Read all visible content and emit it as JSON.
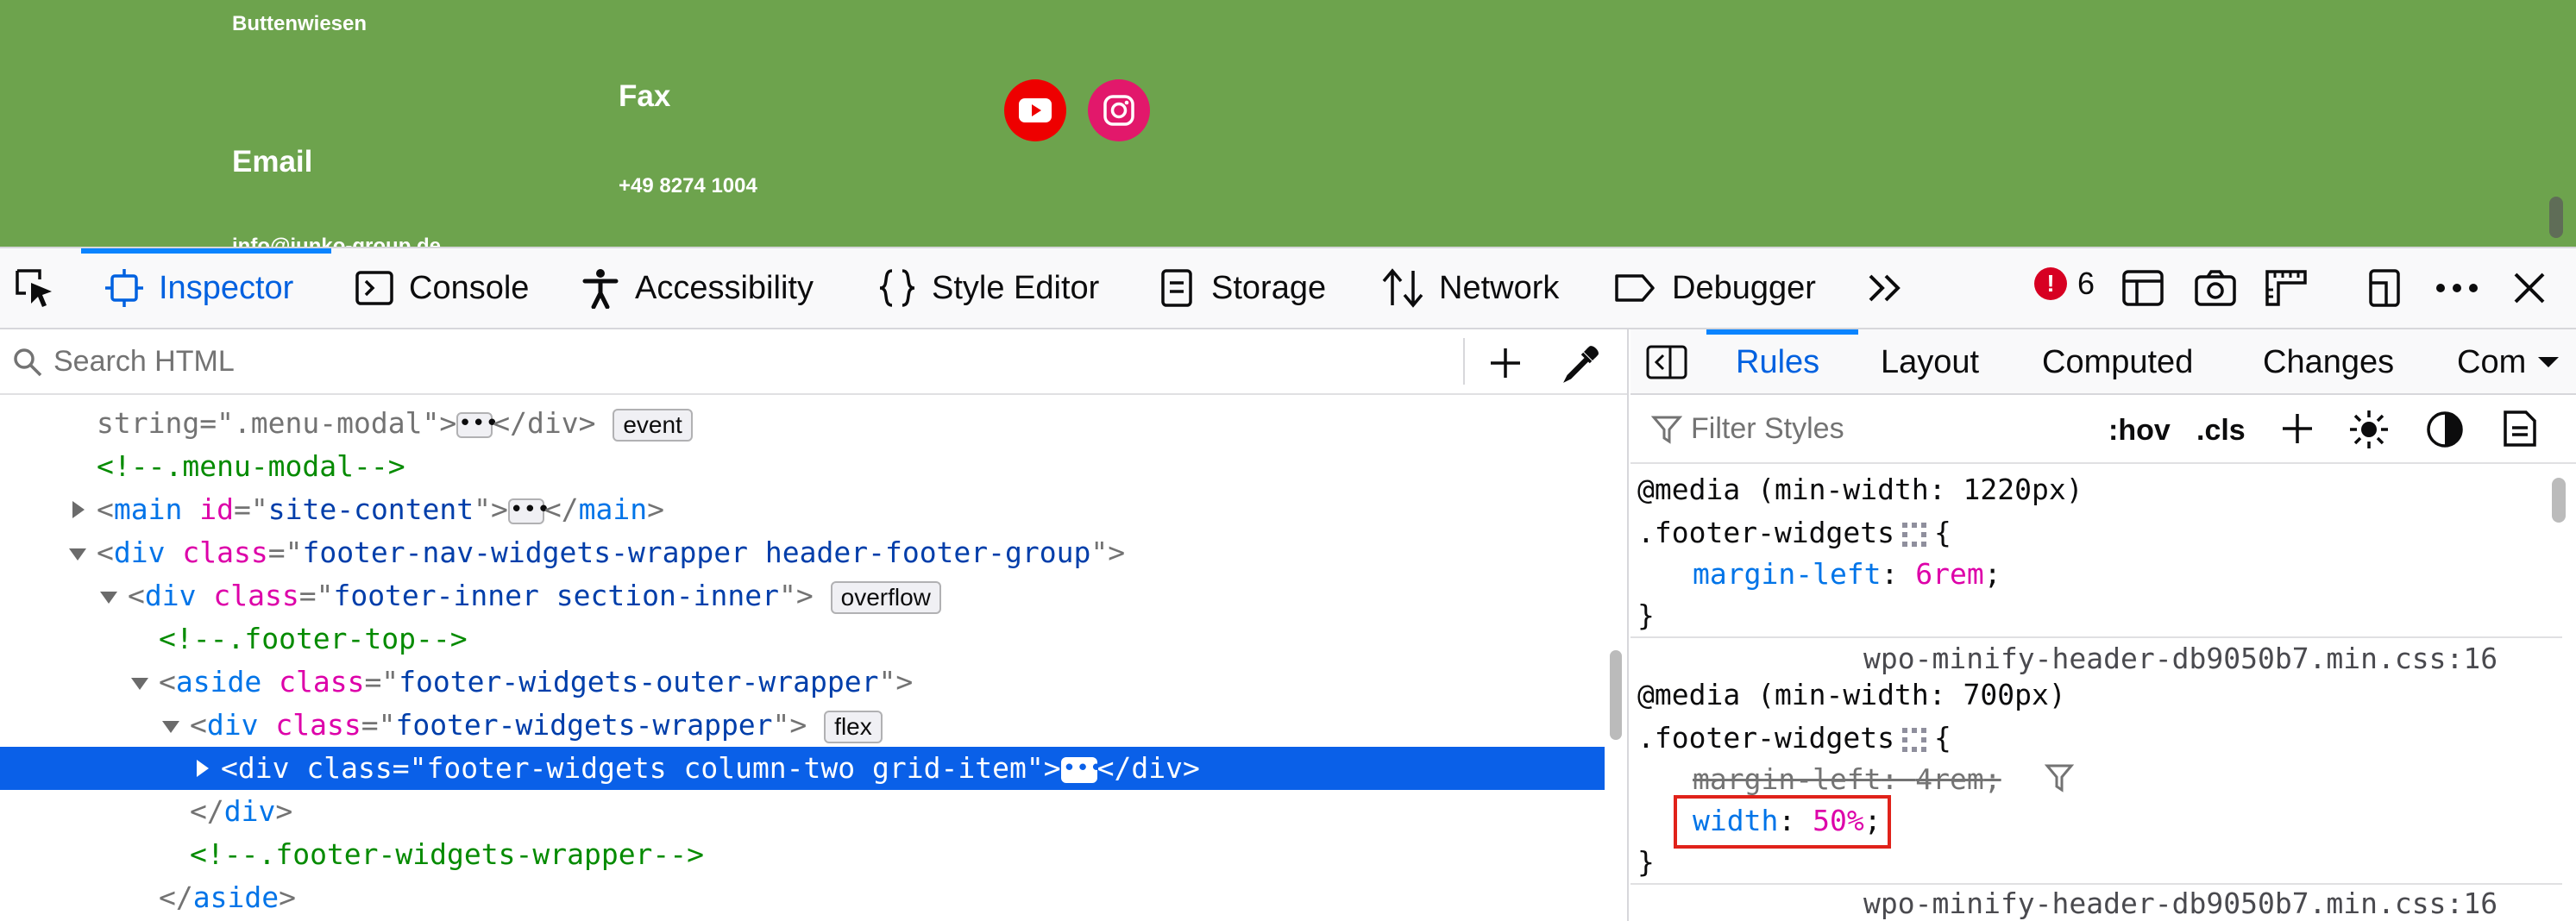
{
  "site": {
    "city": "Buttenwiesen",
    "fax_heading": "Fax",
    "fax_value": "+49 8274 1004",
    "email_heading": "Email",
    "email_value": "info@junko-group.de",
    "social": [
      "youtube-icon",
      "instagram-icon"
    ],
    "bg_color": "#6da34d"
  },
  "toolbar": {
    "tabs": [
      "Inspector",
      "Console",
      "Accessibility",
      "Style Editor",
      "Storage",
      "Network",
      "Debugger"
    ],
    "selected_tab": "Inspector",
    "error_count": "6",
    "overflow_icon": "double-chevron-icon"
  },
  "markup": {
    "search_placeholder": "Search HTML",
    "lines": [
      {
        "indent": 0,
        "kind": "text",
        "content": "string=\".menu-modal\">",
        "ellipsis": true,
        "tail": "</div>",
        "badge": "event"
      },
      {
        "indent": 0,
        "kind": "comment",
        "content": "<!--.menu-modal-->"
      },
      {
        "indent": 0,
        "kind": "collapsed",
        "tag": "main",
        "attrs": [
          [
            "id",
            "site-content"
          ]
        ],
        "ellipsis": true,
        "close": "main"
      },
      {
        "indent": 0,
        "kind": "open",
        "tag": "div",
        "attrs": [
          [
            "class",
            "footer-nav-widgets-wrapper header-footer-group"
          ]
        ]
      },
      {
        "indent": 1,
        "kind": "open",
        "tag": "div",
        "attrs": [
          [
            "class",
            "footer-inner section-inner"
          ]
        ],
        "badge": "overflow"
      },
      {
        "indent": 2,
        "kind": "comment",
        "content": "<!--.footer-top-->"
      },
      {
        "indent": 2,
        "kind": "open",
        "tag": "aside",
        "attrs": [
          [
            "class",
            "footer-widgets-outer-wrapper"
          ]
        ]
      },
      {
        "indent": 3,
        "kind": "open",
        "tag": "div",
        "attrs": [
          [
            "class",
            "footer-widgets-wrapper"
          ]
        ],
        "badge": "flex"
      },
      {
        "indent": 4,
        "kind": "collapsed",
        "tag": "div",
        "attrs": [
          [
            "class",
            "footer-widgets column-two grid-item"
          ]
        ],
        "ellipsis": true,
        "close": "div",
        "selected": true
      },
      {
        "indent": 3,
        "kind": "close",
        "tag": "div"
      },
      {
        "indent": 3,
        "kind": "comment",
        "content": "<!--.footer-widgets-wrapper-->"
      },
      {
        "indent": 2,
        "kind": "close",
        "tag": "aside"
      }
    ]
  },
  "sidebar": {
    "tabs": [
      "Rules",
      "Layout",
      "Computed",
      "Changes",
      "Com"
    ],
    "selected_tab": "Rules",
    "filter_placeholder": "Filter Styles",
    "hov": ":hov",
    "cls": ".cls",
    "rule1": {
      "media": "@media (min-width: 1220px)",
      "selector": ".footer-widgets",
      "prop": "margin-left",
      "value": "6rem"
    },
    "rule2": {
      "source": "wpo-minify-header-db9050b7.min.css:16",
      "media": "@media (min-width: 700px)",
      "selector": ".footer-widgets",
      "prop1": "margin-left",
      "value1": "4rem",
      "prop2": "width",
      "value2": "50%"
    },
    "rule3_source": "wpo-minify-header-db9050b7.min.css:16",
    "open_brace": "{",
    "close_brace": "}"
  }
}
